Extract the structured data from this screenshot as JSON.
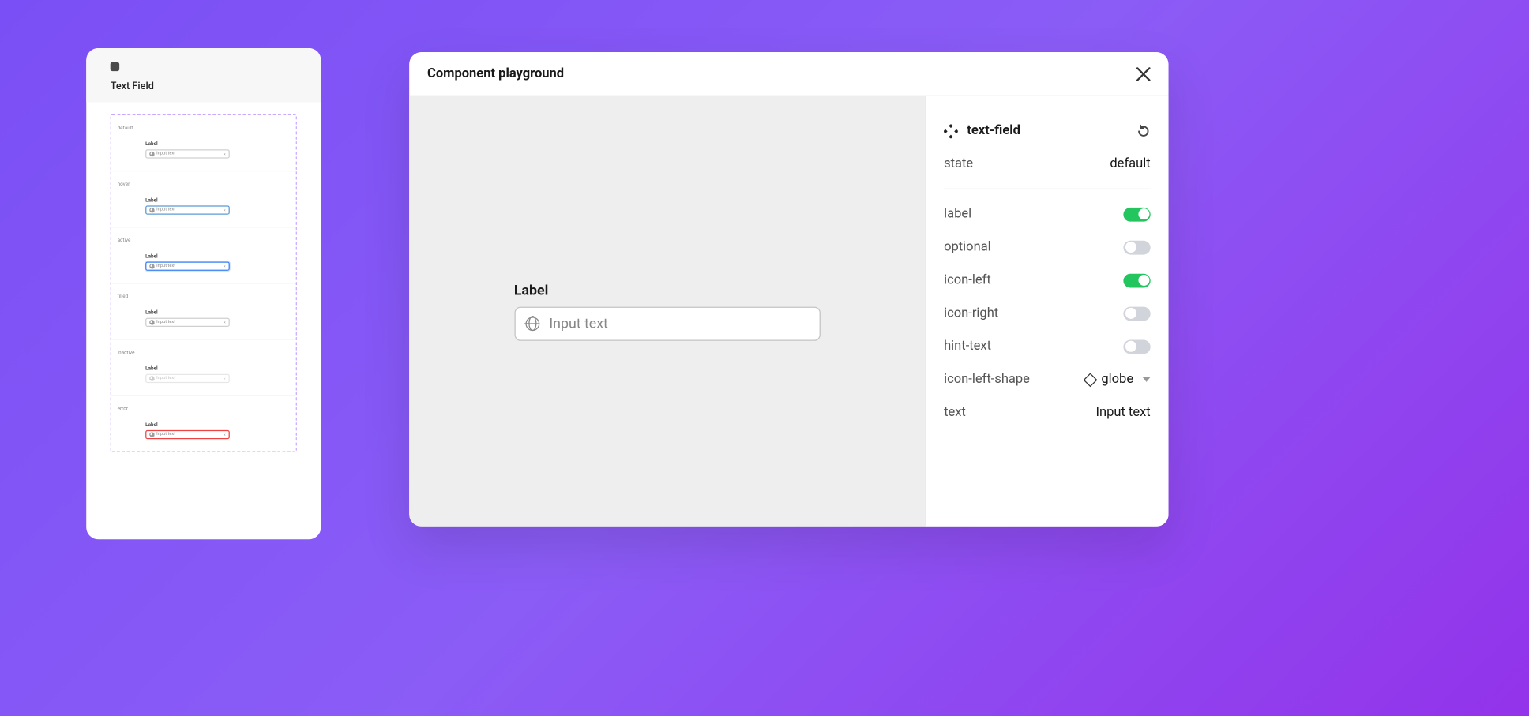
{
  "leftPanel": {
    "title": "Text Field",
    "variants": [
      {
        "state": "default",
        "label": "Label",
        "text": "Input text"
      },
      {
        "state": "hover",
        "label": "Label",
        "text": "Input text"
      },
      {
        "state": "active",
        "label": "Label",
        "text": "Input text"
      },
      {
        "state": "filled",
        "label": "Label",
        "text": "Input text"
      },
      {
        "state": "inactive",
        "label": "Label",
        "text": "Input text"
      },
      {
        "state": "error",
        "label": "Label",
        "text": "Input text"
      }
    ]
  },
  "playground": {
    "title": "Component playground",
    "canvas": {
      "label": "Label",
      "placeholder": "Input text"
    }
  },
  "sidebar": {
    "componentName": "text-field",
    "props": {
      "stateLabel": "state",
      "stateValue": "default",
      "labelLabel": "label",
      "labelOn": true,
      "optionalLabel": "optional",
      "optionalOn": false,
      "iconLeftLabel": "icon-left",
      "iconLeftOn": true,
      "iconRightLabel": "icon-right",
      "iconRightOn": false,
      "hintTextLabel": "hint-text",
      "hintTextOn": false,
      "iconLeftShapeLabel": "icon-left-shape",
      "iconLeftShapeValue": "globe",
      "textLabel": "text",
      "textValue": "Input text"
    }
  }
}
